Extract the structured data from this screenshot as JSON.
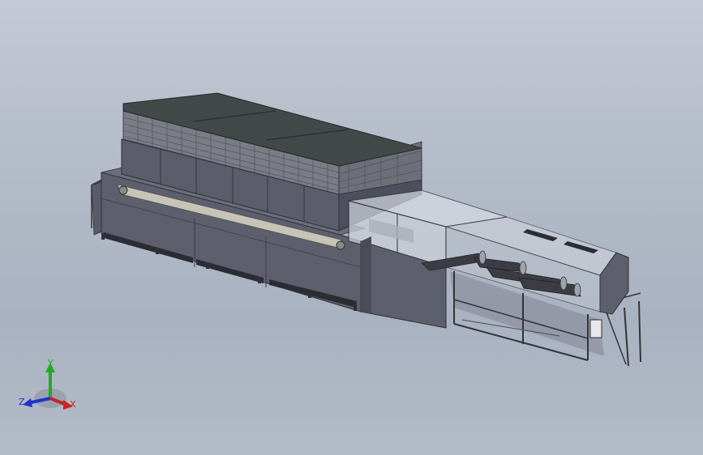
{
  "viewport": {
    "background_top": "#c4cad5",
    "background_bottom": "#b3bbc8"
  },
  "model": {
    "colors": {
      "body_dark": "#4e4f5c",
      "body_mid": "#5e5f6d",
      "body_light": "#6c6d7b",
      "top_cover": "#414a48",
      "mesh": "#7a7c86",
      "glass": "#c9d0d9",
      "frame": "#2f3038",
      "rail": "#c8c3b8",
      "pipe": "#3c3d44"
    },
    "icons": [
      "model-view",
      "coordinate-triad-icon"
    ]
  },
  "triad": {
    "y_label": "Y",
    "z_label": "Z",
    "x_label": "X",
    "y_color": "#22aa22",
    "z_color": "#2233cc",
    "x_color": "#cc2222"
  }
}
